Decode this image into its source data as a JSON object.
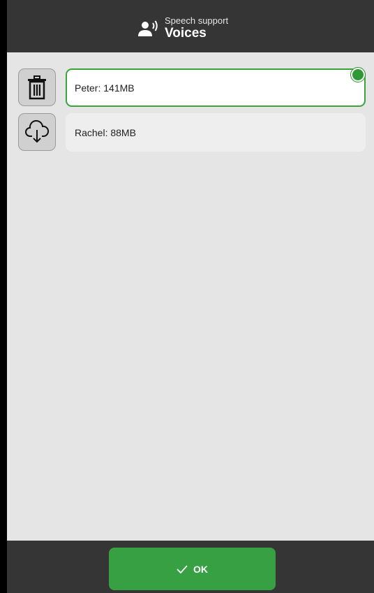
{
  "header": {
    "subtitle": "Speech support",
    "title": "Voices",
    "icon": "speaker-person-icon"
  },
  "voices": [
    {
      "label": "Peter: 141MB",
      "selected": true,
      "action_icon": "trash-icon"
    },
    {
      "label": "Rachel: 88MB",
      "selected": false,
      "action_icon": "cloud-download-icon"
    }
  ],
  "footer": {
    "ok_label": "OK",
    "ok_icon": "check-icon"
  },
  "colors": {
    "header_bg": "#353535",
    "content_bg": "#e5e5e5",
    "accent_green": "#36a043",
    "selected_border": "#3aa43a"
  }
}
